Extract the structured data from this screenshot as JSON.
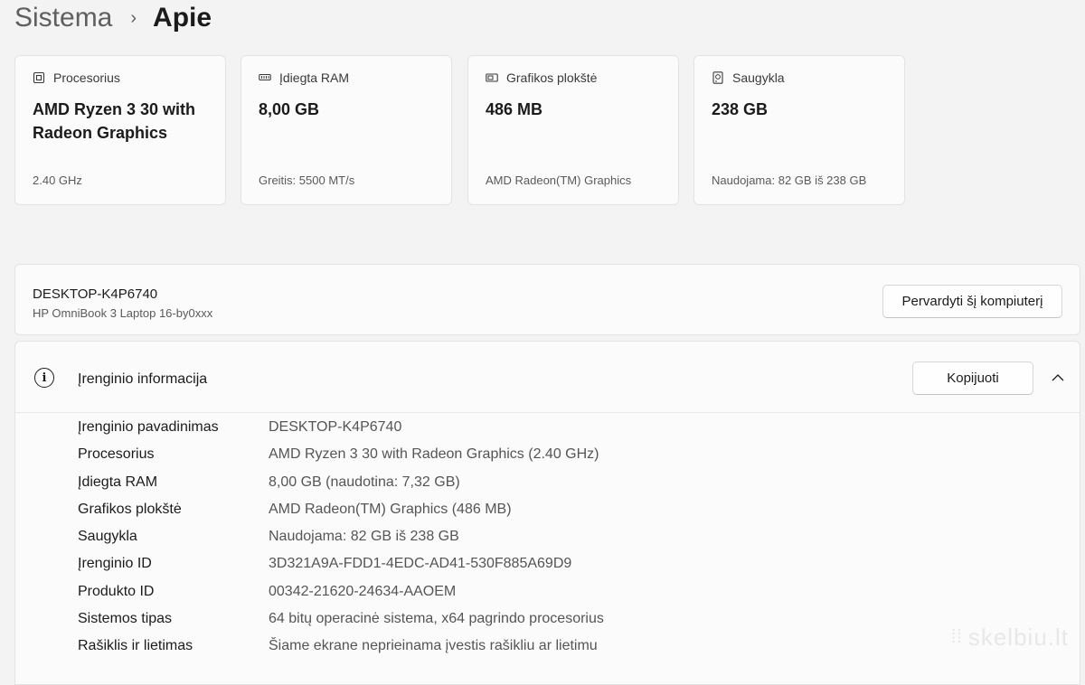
{
  "breadcrumb": {
    "parent": "Sistema",
    "separator": "›",
    "current": "Apie"
  },
  "cards": [
    {
      "icon": "cpu-icon",
      "label": "Procesorius",
      "value": "AMD Ryzen 3 30 with Radeon Graphics",
      "sub": "2.40 GHz"
    },
    {
      "icon": "ram-icon",
      "label": "Įdiegta RAM",
      "value": "8,00 GB",
      "sub": "Greitis: 5500 MT/s"
    },
    {
      "icon": "gpu-icon",
      "label": "Grafikos plokštė",
      "value": "486 MB",
      "sub": "AMD Radeon(TM) Graphics"
    },
    {
      "icon": "storage-icon",
      "label": "Saugykla",
      "value": "238 GB",
      "sub": "Naudojama: 82 GB iš 238 GB"
    }
  ],
  "rename_panel": {
    "device_name": "DESKTOP-K4P6740",
    "model": "HP OmniBook 3 Laptop 16-by0xxx",
    "button": "Pervardyti šį kompiuterį"
  },
  "device_info": {
    "title": "Įrenginio informacija",
    "copy_button": "Kopijuoti",
    "rows": [
      {
        "key": "Įrenginio pavadinimas",
        "value": "DESKTOP-K4P6740"
      },
      {
        "key": "Procesorius",
        "value": "AMD Ryzen 3 30 with Radeon Graphics (2.40 GHz)"
      },
      {
        "key": "Įdiegta RAM",
        "value": "8,00 GB (naudotina: 7,32 GB)"
      },
      {
        "key": "Grafikos plokštė",
        "value": "AMD Radeon(TM) Graphics (486 MB)"
      },
      {
        "key": "Saugykla",
        "value": "Naudojama: 82 GB iš 238 GB"
      },
      {
        "key": "Įrenginio ID",
        "value": "3D321A9A-FDD1-4EDC-AD41-530F885A69D9"
      },
      {
        "key": "Produkto ID",
        "value": "00342-21620-24634-AAOEM"
      },
      {
        "key": "Sistemos tipas",
        "value": "64 bitų operacinė sistema, x64 pagrindo procesorius"
      },
      {
        "key": "Rašiklis ir lietimas",
        "value": "Šiame ekrane neprieinama įvestis rašikliu ar lietimu"
      }
    ]
  },
  "watermark": "skelbiu.lt"
}
